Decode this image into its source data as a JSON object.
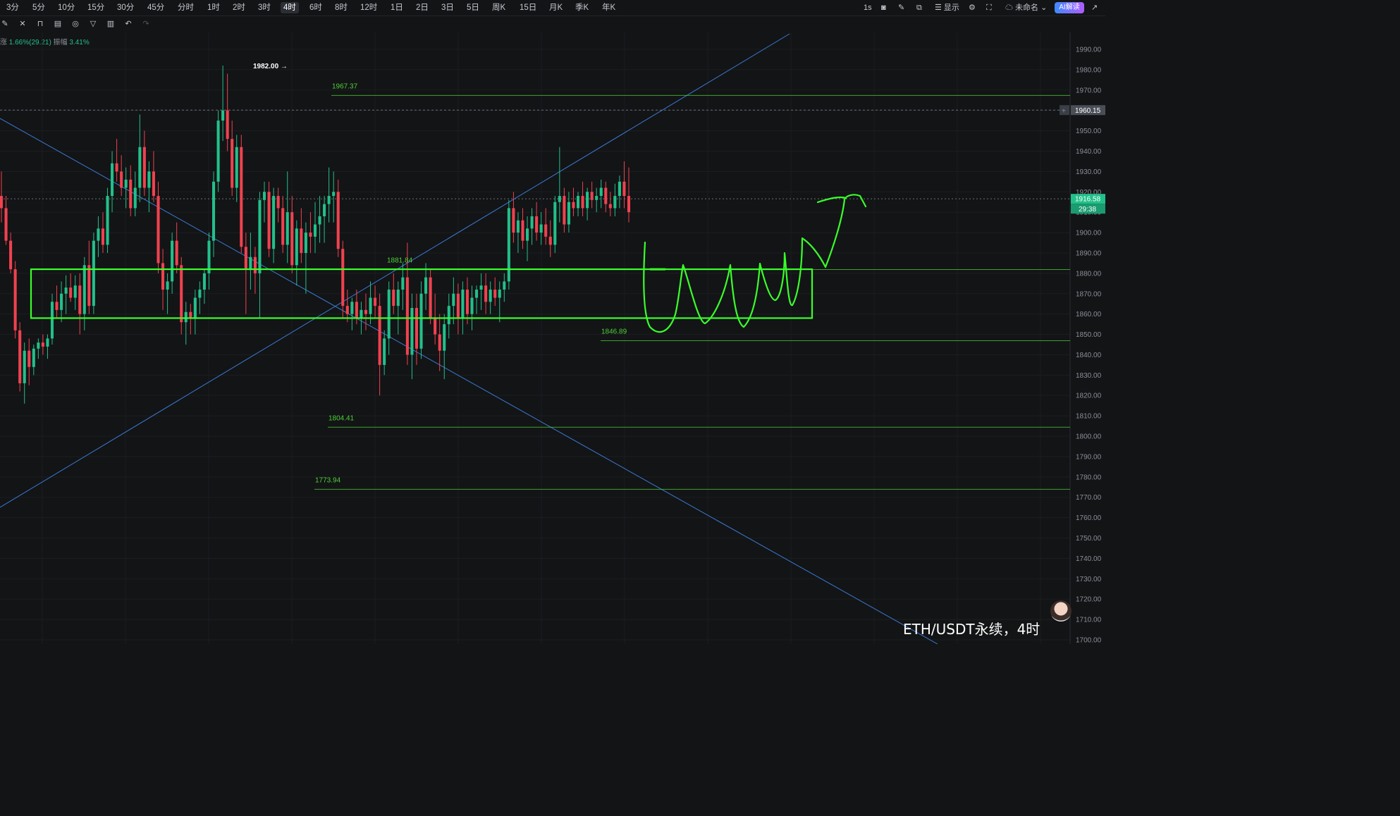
{
  "toolbar": {
    "timeframes": [
      "3分",
      "5分",
      "10分",
      "15分",
      "30分",
      "45分",
      "分时",
      "1时",
      "2时",
      "3时",
      "4时",
      "6时",
      "8时",
      "12时",
      "1日",
      "2日",
      "3日",
      "5日",
      "周K",
      "15日",
      "月K",
      "季K",
      "年K"
    ],
    "active_timeframe": "4时",
    "interval_label": "1s",
    "display_label": "显示",
    "layout_name": "未命名",
    "ai_label": "AI解读"
  },
  "drawing_tools": [
    "pen-icon",
    "crossed-tool-icon",
    "lock-icon",
    "template-icon",
    "magnet-icon",
    "filter-icon",
    "trash-icon",
    "undo-icon",
    "redo-icon"
  ],
  "info": {
    "change_label": "涨",
    "change_value": "1.66%(29.21)",
    "amplitude_label": "振幅",
    "amplitude_value": "3.41%"
  },
  "symbol_label": "ETH/USDT永续，4时",
  "colors": {
    "up": "#22c08a",
    "down": "#f0424f",
    "level": "#4cd137",
    "trendline": "#3a7bd5",
    "drawing": "#39ff2a"
  },
  "chart_data": {
    "type": "candlestick",
    "ylim": [
      1700,
      1993
    ],
    "y_ticks": [
      1990,
      1980,
      1970,
      1960,
      1950,
      1940,
      1930,
      1920,
      1910,
      1900,
      1890,
      1880,
      1870,
      1860,
      1850,
      1840,
      1830,
      1820,
      1810,
      1800,
      1790,
      1780,
      1770,
      1760,
      1750,
      1740,
      1730,
      1720,
      1710,
      1700
    ],
    "y_tick_labels": [
      "1990.00",
      "1980.00",
      "1970.00",
      "1960.00",
      "1950.00",
      "1940.00",
      "1930.00",
      "1920.00",
      "1910.00",
      "1900.00",
      "1890.00",
      "1880.00",
      "1870.00",
      "1860.00",
      "1850.00",
      "1840.00",
      "1830.00",
      "1820.00",
      "1810.00",
      "1800.00",
      "1790.00",
      "1780.00",
      "1770.00",
      "1760.00",
      "1750.00",
      "1740.00",
      "1730.00",
      "1720.00",
      "1710.00",
      "1700.00"
    ],
    "last_price": 1916.58,
    "last_price_label": "1916.58",
    "countdown": "29:38",
    "crosshair_price": 1960.15,
    "crosshair_label": "1960.15",
    "max_marker": {
      "label": "1982.00 →",
      "value": 1982.0
    },
    "levels": [
      {
        "value": 1967.37,
        "label": "1967.37"
      },
      {
        "value": 1881.84,
        "label": "1881.84"
      },
      {
        "value": 1846.89,
        "label": "1846.89"
      },
      {
        "value": 1804.41,
        "label": "1804.41"
      },
      {
        "value": 1773.94,
        "label": "1773.94"
      }
    ],
    "box_zone": [
      1858,
      1882
    ],
    "candles": [
      {
        "o": 1918,
        "h": 1930,
        "l": 1905,
        "c": 1912
      },
      {
        "o": 1912,
        "h": 1918,
        "l": 1894,
        "c": 1896
      },
      {
        "o": 1896,
        "h": 1900,
        "l": 1880,
        "c": 1882
      },
      {
        "o": 1882,
        "h": 1886,
        "l": 1848,
        "c": 1852
      },
      {
        "o": 1852,
        "h": 1856,
        "l": 1822,
        "c": 1826
      },
      {
        "o": 1826,
        "h": 1846,
        "l": 1816,
        "c": 1842
      },
      {
        "o": 1842,
        "h": 1848,
        "l": 1825,
        "c": 1834
      },
      {
        "o": 1834,
        "h": 1845,
        "l": 1830,
        "c": 1843
      },
      {
        "o": 1843,
        "h": 1848,
        "l": 1838,
        "c": 1846
      },
      {
        "o": 1846,
        "h": 1850,
        "l": 1840,
        "c": 1844
      },
      {
        "o": 1844,
        "h": 1850,
        "l": 1838,
        "c": 1848
      },
      {
        "o": 1848,
        "h": 1870,
        "l": 1845,
        "c": 1866
      },
      {
        "o": 1866,
        "h": 1874,
        "l": 1858,
        "c": 1862
      },
      {
        "o": 1862,
        "h": 1876,
        "l": 1856,
        "c": 1870
      },
      {
        "o": 1870,
        "h": 1879,
        "l": 1860,
        "c": 1873
      },
      {
        "o": 1873,
        "h": 1880,
        "l": 1866,
        "c": 1868
      },
      {
        "o": 1868,
        "h": 1879,
        "l": 1862,
        "c": 1874
      },
      {
        "o": 1874,
        "h": 1880,
        "l": 1850,
        "c": 1860
      },
      {
        "o": 1860,
        "h": 1888,
        "l": 1852,
        "c": 1884
      },
      {
        "o": 1884,
        "h": 1896,
        "l": 1860,
        "c": 1864
      },
      {
        "o": 1864,
        "h": 1900,
        "l": 1860,
        "c": 1896
      },
      {
        "o": 1896,
        "h": 1908,
        "l": 1888,
        "c": 1902
      },
      {
        "o": 1902,
        "h": 1910,
        "l": 1890,
        "c": 1894
      },
      {
        "o": 1894,
        "h": 1922,
        "l": 1890,
        "c": 1918
      },
      {
        "o": 1918,
        "h": 1940,
        "l": 1910,
        "c": 1934
      },
      {
        "o": 1934,
        "h": 1946,
        "l": 1925,
        "c": 1930
      },
      {
        "o": 1930,
        "h": 1938,
        "l": 1918,
        "c": 1922
      },
      {
        "o": 1922,
        "h": 1932,
        "l": 1912,
        "c": 1926
      },
      {
        "o": 1926,
        "h": 1933,
        "l": 1908,
        "c": 1912
      },
      {
        "o": 1912,
        "h": 1930,
        "l": 1908,
        "c": 1922
      },
      {
        "o": 1922,
        "h": 1958,
        "l": 1915,
        "c": 1942
      },
      {
        "o": 1942,
        "h": 1950,
        "l": 1918,
        "c": 1922
      },
      {
        "o": 1922,
        "h": 1935,
        "l": 1910,
        "c": 1930
      },
      {
        "o": 1930,
        "h": 1940,
        "l": 1915,
        "c": 1918
      },
      {
        "o": 1918,
        "h": 1925,
        "l": 1880,
        "c": 1885
      },
      {
        "o": 1885,
        "h": 1892,
        "l": 1862,
        "c": 1872
      },
      {
        "o": 1872,
        "h": 1880,
        "l": 1860,
        "c": 1876
      },
      {
        "o": 1876,
        "h": 1900,
        "l": 1870,
        "c": 1896
      },
      {
        "o": 1896,
        "h": 1905,
        "l": 1880,
        "c": 1884
      },
      {
        "o": 1884,
        "h": 1888,
        "l": 1850,
        "c": 1856
      },
      {
        "o": 1856,
        "h": 1866,
        "l": 1845,
        "c": 1861
      },
      {
        "o": 1861,
        "h": 1865,
        "l": 1850,
        "c": 1858
      },
      {
        "o": 1858,
        "h": 1872,
        "l": 1850,
        "c": 1868
      },
      {
        "o": 1868,
        "h": 1876,
        "l": 1860,
        "c": 1872
      },
      {
        "o": 1872,
        "h": 1882,
        "l": 1865,
        "c": 1880
      },
      {
        "o": 1880,
        "h": 1900,
        "l": 1872,
        "c": 1896
      },
      {
        "o": 1896,
        "h": 1930,
        "l": 1888,
        "c": 1925
      },
      {
        "o": 1925,
        "h": 1960,
        "l": 1920,
        "c": 1955
      },
      {
        "o": 1955,
        "h": 1982,
        "l": 1945,
        "c": 1960
      },
      {
        "o": 1960,
        "h": 1978,
        "l": 1940,
        "c": 1946
      },
      {
        "o": 1946,
        "h": 1955,
        "l": 1918,
        "c": 1922
      },
      {
        "o": 1922,
        "h": 1948,
        "l": 1915,
        "c": 1942
      },
      {
        "o": 1942,
        "h": 1948,
        "l": 1890,
        "c": 1893
      },
      {
        "o": 1893,
        "h": 1900,
        "l": 1860,
        "c": 1882
      },
      {
        "o": 1882,
        "h": 1900,
        "l": 1872,
        "c": 1888
      },
      {
        "o": 1888,
        "h": 1893,
        "l": 1870,
        "c": 1880
      },
      {
        "o": 1880,
        "h": 1920,
        "l": 1858,
        "c": 1916
      },
      {
        "o": 1916,
        "h": 1925,
        "l": 1905,
        "c": 1920
      },
      {
        "o": 1920,
        "h": 1925,
        "l": 1888,
        "c": 1892
      },
      {
        "o": 1892,
        "h": 1922,
        "l": 1885,
        "c": 1918
      },
      {
        "o": 1918,
        "h": 1922,
        "l": 1905,
        "c": 1912
      },
      {
        "o": 1912,
        "h": 1918,
        "l": 1890,
        "c": 1894
      },
      {
        "o": 1894,
        "h": 1930,
        "l": 1885,
        "c": 1910
      },
      {
        "o": 1910,
        "h": 1918,
        "l": 1880,
        "c": 1884
      },
      {
        "o": 1884,
        "h": 1906,
        "l": 1874,
        "c": 1902
      },
      {
        "o": 1902,
        "h": 1912,
        "l": 1885,
        "c": 1890
      },
      {
        "o": 1890,
        "h": 1905,
        "l": 1870,
        "c": 1900
      },
      {
        "o": 1900,
        "h": 1910,
        "l": 1890,
        "c": 1898
      },
      {
        "o": 1898,
        "h": 1915,
        "l": 1890,
        "c": 1904
      },
      {
        "o": 1904,
        "h": 1918,
        "l": 1895,
        "c": 1908
      },
      {
        "o": 1908,
        "h": 1918,
        "l": 1895,
        "c": 1914
      },
      {
        "o": 1914,
        "h": 1932,
        "l": 1905,
        "c": 1918
      },
      {
        "o": 1918,
        "h": 1930,
        "l": 1905,
        "c": 1920
      },
      {
        "o": 1920,
        "h": 1926,
        "l": 1888,
        "c": 1892
      },
      {
        "o": 1892,
        "h": 1896,
        "l": 1858,
        "c": 1864
      },
      {
        "o": 1864,
        "h": 1872,
        "l": 1856,
        "c": 1860
      },
      {
        "o": 1860,
        "h": 1868,
        "l": 1852,
        "c": 1866
      },
      {
        "o": 1866,
        "h": 1872,
        "l": 1855,
        "c": 1858
      },
      {
        "o": 1858,
        "h": 1866,
        "l": 1850,
        "c": 1862
      },
      {
        "o": 1862,
        "h": 1870,
        "l": 1852,
        "c": 1860
      },
      {
        "o": 1860,
        "h": 1876,
        "l": 1855,
        "c": 1868
      },
      {
        "o": 1868,
        "h": 1874,
        "l": 1858,
        "c": 1864
      },
      {
        "o": 1864,
        "h": 1870,
        "l": 1820,
        "c": 1835
      },
      {
        "o": 1835,
        "h": 1852,
        "l": 1830,
        "c": 1848
      },
      {
        "o": 1848,
        "h": 1876,
        "l": 1840,
        "c": 1872
      },
      {
        "o": 1872,
        "h": 1880,
        "l": 1860,
        "c": 1864
      },
      {
        "o": 1864,
        "h": 1876,
        "l": 1850,
        "c": 1872
      },
      {
        "o": 1872,
        "h": 1885,
        "l": 1862,
        "c": 1878
      },
      {
        "o": 1878,
        "h": 1895,
        "l": 1835,
        "c": 1840
      },
      {
        "o": 1840,
        "h": 1870,
        "l": 1828,
        "c": 1863
      },
      {
        "o": 1863,
        "h": 1870,
        "l": 1835,
        "c": 1843
      },
      {
        "o": 1843,
        "h": 1876,
        "l": 1838,
        "c": 1870
      },
      {
        "o": 1870,
        "h": 1885,
        "l": 1862,
        "c": 1878
      },
      {
        "o": 1878,
        "h": 1882,
        "l": 1855,
        "c": 1858
      },
      {
        "o": 1858,
        "h": 1870,
        "l": 1845,
        "c": 1850
      },
      {
        "o": 1850,
        "h": 1860,
        "l": 1832,
        "c": 1842
      },
      {
        "o": 1842,
        "h": 1860,
        "l": 1828,
        "c": 1855
      },
      {
        "o": 1855,
        "h": 1870,
        "l": 1848,
        "c": 1864
      },
      {
        "o": 1864,
        "h": 1878,
        "l": 1855,
        "c": 1870
      },
      {
        "o": 1870,
        "h": 1875,
        "l": 1850,
        "c": 1858
      },
      {
        "o": 1858,
        "h": 1876,
        "l": 1850,
        "c": 1872
      },
      {
        "o": 1872,
        "h": 1878,
        "l": 1855,
        "c": 1860
      },
      {
        "o": 1860,
        "h": 1874,
        "l": 1852,
        "c": 1868
      },
      {
        "o": 1868,
        "h": 1874,
        "l": 1860,
        "c": 1872
      },
      {
        "o": 1872,
        "h": 1880,
        "l": 1862,
        "c": 1874
      },
      {
        "o": 1874,
        "h": 1880,
        "l": 1860,
        "c": 1866
      },
      {
        "o": 1866,
        "h": 1876,
        "l": 1860,
        "c": 1872
      },
      {
        "o": 1872,
        "h": 1878,
        "l": 1864,
        "c": 1868
      },
      {
        "o": 1868,
        "h": 1876,
        "l": 1856,
        "c": 1872
      },
      {
        "o": 1872,
        "h": 1880,
        "l": 1866,
        "c": 1876
      },
      {
        "o": 1876,
        "h": 1916,
        "l": 1872,
        "c": 1912
      },
      {
        "o": 1912,
        "h": 1920,
        "l": 1895,
        "c": 1900
      },
      {
        "o": 1900,
        "h": 1910,
        "l": 1890,
        "c": 1906
      },
      {
        "o": 1906,
        "h": 1912,
        "l": 1892,
        "c": 1896
      },
      {
        "o": 1896,
        "h": 1908,
        "l": 1886,
        "c": 1902
      },
      {
        "o": 1902,
        "h": 1912,
        "l": 1894,
        "c": 1908
      },
      {
        "o": 1908,
        "h": 1915,
        "l": 1896,
        "c": 1900
      },
      {
        "o": 1900,
        "h": 1910,
        "l": 1894,
        "c": 1904
      },
      {
        "o": 1904,
        "h": 1912,
        "l": 1894,
        "c": 1898
      },
      {
        "o": 1898,
        "h": 1906,
        "l": 1888,
        "c": 1894
      },
      {
        "o": 1894,
        "h": 1918,
        "l": 1890,
        "c": 1915
      },
      {
        "o": 1915,
        "h": 1942,
        "l": 1905,
        "c": 1918
      },
      {
        "o": 1918,
        "h": 1922,
        "l": 1900,
        "c": 1904
      },
      {
        "o": 1904,
        "h": 1920,
        "l": 1900,
        "c": 1915
      },
      {
        "o": 1915,
        "h": 1922,
        "l": 1908,
        "c": 1912
      },
      {
        "o": 1912,
        "h": 1920,
        "l": 1908,
        "c": 1918
      },
      {
        "o": 1918,
        "h": 1925,
        "l": 1908,
        "c": 1912
      },
      {
        "o": 1912,
        "h": 1922,
        "l": 1906,
        "c": 1920
      },
      {
        "o": 1920,
        "h": 1925,
        "l": 1912,
        "c": 1916
      },
      {
        "o": 1916,
        "h": 1922,
        "l": 1910,
        "c": 1918
      },
      {
        "o": 1918,
        "h": 1926,
        "l": 1912,
        "c": 1922
      },
      {
        "o": 1922,
        "h": 1925,
        "l": 1910,
        "c": 1914
      },
      {
        "o": 1914,
        "h": 1920,
        "l": 1908,
        "c": 1912
      },
      {
        "o": 1912,
        "h": 1924,
        "l": 1908,
        "c": 1918
      },
      {
        "o": 1918,
        "h": 1928,
        "l": 1912,
        "c": 1925
      },
      {
        "o": 1925,
        "h": 1935,
        "l": 1912,
        "c": 1918
      },
      {
        "o": 1918,
        "h": 1932,
        "l": 1905,
        "c": 1910
      }
    ]
  }
}
